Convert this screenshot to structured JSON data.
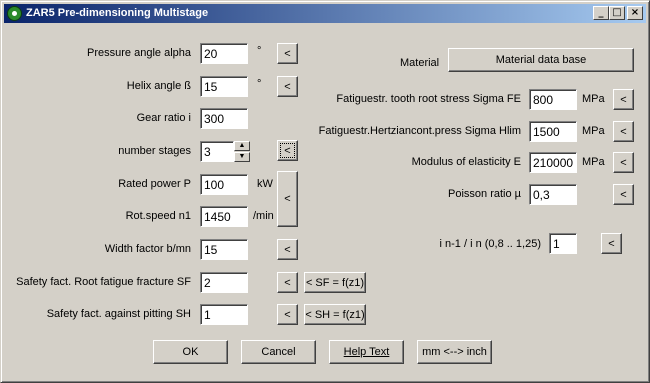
{
  "window": {
    "title": "ZAR5 Pre-dimensioning Multistage",
    "minimize_glyph": "_",
    "maximize_glyph": "□",
    "close_glyph": "×"
  },
  "left": {
    "pressure_angle": {
      "label": "Pressure angle alpha",
      "value": "20",
      "unit": "°",
      "btn": "<"
    },
    "helix_angle": {
      "label": "Helix angle ß",
      "value": "15",
      "unit": "°",
      "btn": "<"
    },
    "gear_ratio": {
      "label": "Gear ratio i",
      "value": "300"
    },
    "stages": {
      "label": "number stages",
      "value": "3",
      "btn": "<"
    },
    "rated_power": {
      "label": "Rated power P",
      "value": "100",
      "unit": "kW"
    },
    "rot_speed": {
      "label": "Rot.speed n1",
      "value": "1450",
      "unit": "/min",
      "btn": "<"
    },
    "width_factor": {
      "label": "Width factor b/mn",
      "value": "15",
      "btn": "<"
    },
    "safety_sf": {
      "label": "Safety fact. Root fatigue fracture SF",
      "value": "2",
      "btn": "<",
      "formula_btn": "< SF = f(z1)"
    },
    "safety_sh": {
      "label": "Safety fact. against pitting SH",
      "value": "1",
      "btn": "<",
      "formula_btn": "< SH = f(z1)"
    }
  },
  "right": {
    "material_label": "Material",
    "material_button": "Material data base",
    "fe": {
      "label": "Fatiguestr. tooth root stress Sigma FE",
      "value": "800",
      "unit": "MPa",
      "btn": "<"
    },
    "hlim": {
      "label": "Fatiguestr.Hertziancont.press Sigma Hlim",
      "value": "1500",
      "unit": "MPa",
      "btn": "<"
    },
    "modulus": {
      "label": "Modulus of elasticity E",
      "value": "210000",
      "unit": "MPa",
      "btn": "<"
    },
    "poisson": {
      "label": "Poisson ratio µ",
      "value": "0,3",
      "btn": "<"
    },
    "ratio": {
      "label": "i n-1 / i n  (0,8 .. 1,25)",
      "value": "1",
      "btn": "<"
    }
  },
  "footer": {
    "ok": "OK",
    "cancel": "Cancel",
    "help": "Help Text",
    "units": "mm <--> inch"
  }
}
